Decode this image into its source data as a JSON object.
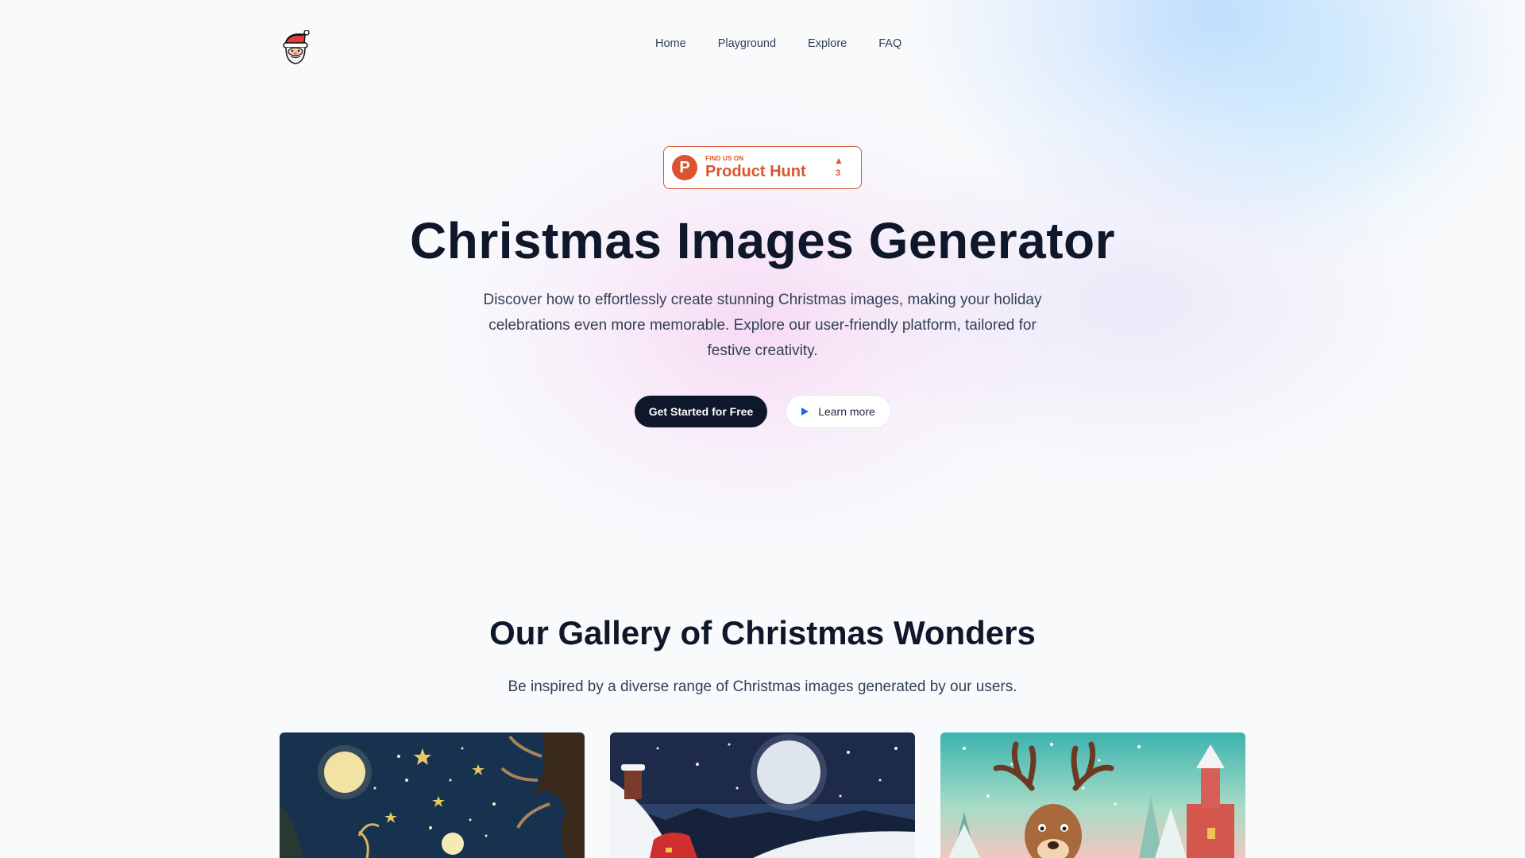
{
  "nav": {
    "logo_icon": "santa-face-icon",
    "links": [
      "Home",
      "Playground",
      "Explore",
      "FAQ"
    ]
  },
  "product_hunt": {
    "small_text": "FIND US ON",
    "big_text": "Product Hunt",
    "logo_letter": "P",
    "upvote_icon": "triangle-up-icon",
    "count": "3",
    "color": "#da552f"
  },
  "hero": {
    "title": "Christmas Images Generator",
    "subtitle": "Discover how to effortlessly create stunning Christmas images, making your holiday celebrations even more memorable. Explore our user-friendly platform, tailored for festive creativity.",
    "primary_button": "Get Started for Free",
    "secondary_button": "Learn more",
    "secondary_icon": "play-icon"
  },
  "gallery": {
    "title": "Our Gallery of Christmas Wonders",
    "subtitle": "Be inspired by a diverse range of Christmas images generated by our users.",
    "images": [
      "night-sky-moon-stars-image",
      "santa-moon-snow-image",
      "reindeer-snowy-village-image"
    ]
  },
  "colors": {
    "primary_button_bg": "#0f172a",
    "accent_blue": "#2563eb",
    "page_bg": "#f8fafc"
  }
}
